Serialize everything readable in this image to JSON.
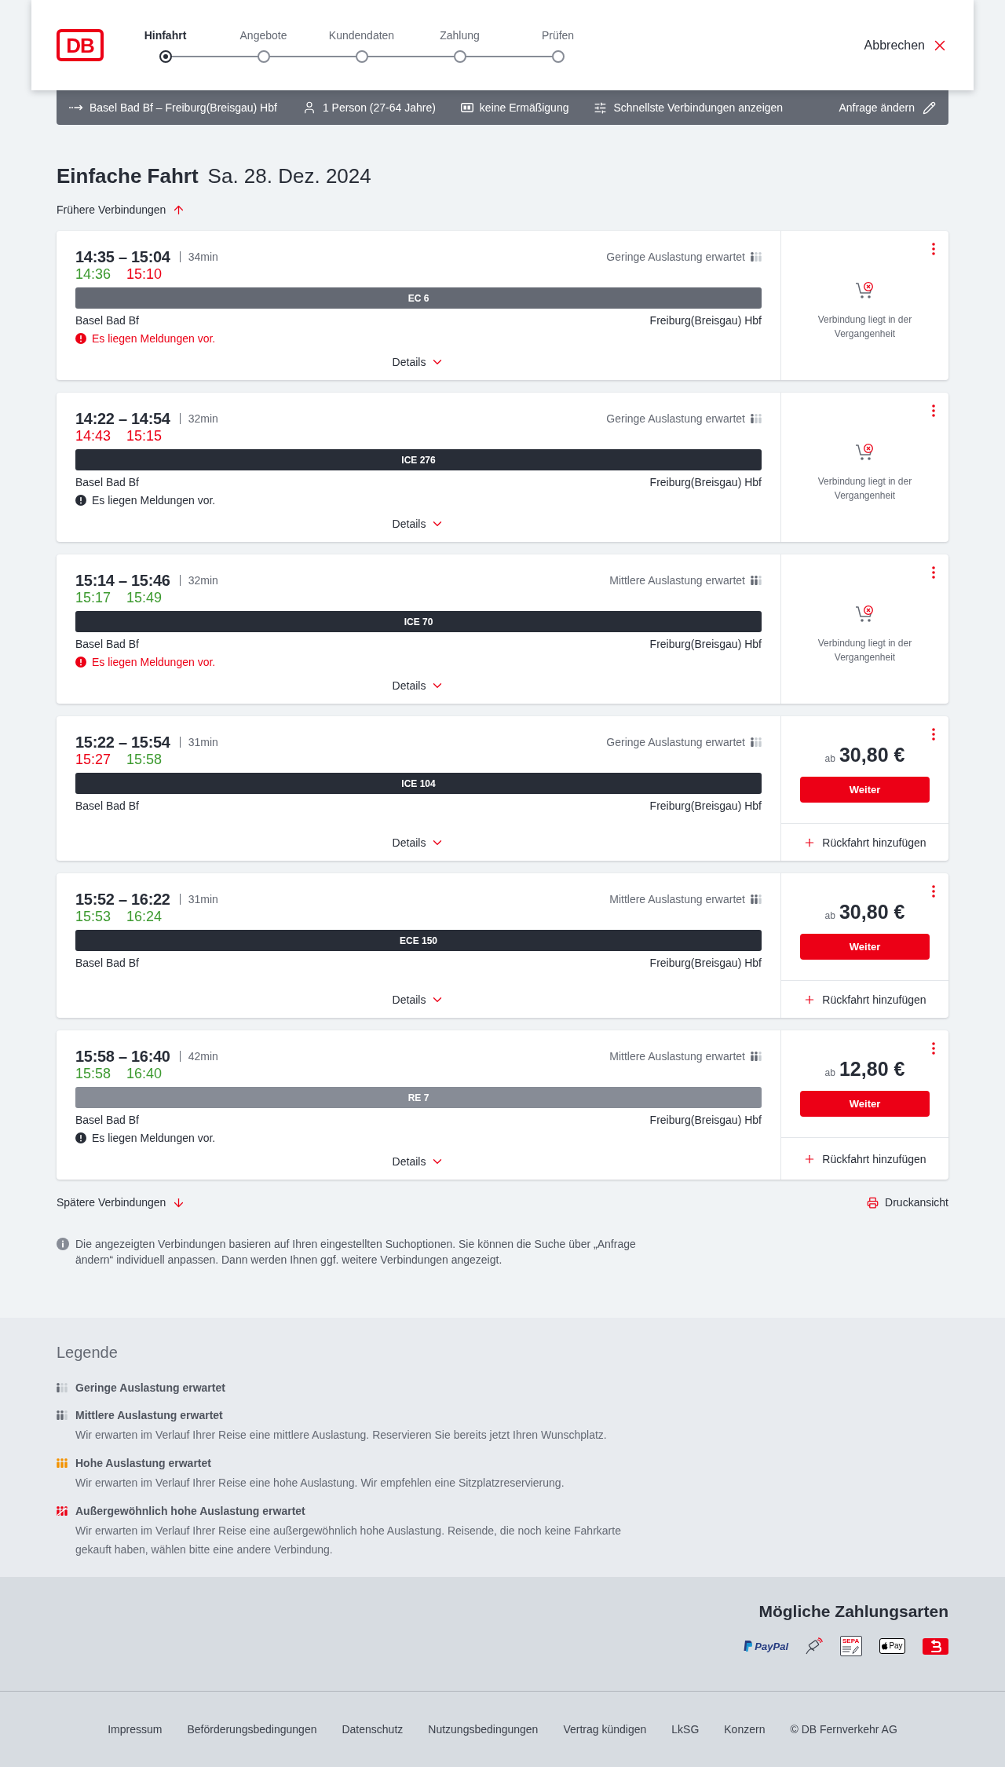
{
  "header": {
    "logo": "DB",
    "steps": [
      {
        "label": "Hinfahrt",
        "selected": true
      },
      {
        "label": "Angebote",
        "selected": false
      },
      {
        "label": "Kundendaten",
        "selected": false
      },
      {
        "label": "Zahlung",
        "selected": false
      },
      {
        "label": "Prüfen",
        "selected": false
      }
    ],
    "cancel": "Abbrechen"
  },
  "search_bar": {
    "route": "Basel Bad Bf – Freiburg(Breisgau) Hbf",
    "travellers": "1 Person (27-64 Jahre)",
    "discount": "keine Ermäßigung",
    "option": "Schnellste Verbindungen anzeigen",
    "edit": "Anfrage ändern"
  },
  "title": {
    "heading": "Einfache Fahrt",
    "date": "Sa. 28. Dez. 2024"
  },
  "earlier": "Frühere Verbindungen",
  "connections": [
    {
      "planned": "14:35 – 15:04",
      "duration": "34min",
      "occupancy": {
        "kind": "low",
        "label": "Geringe Auslastung erwartet"
      },
      "actual": [
        {
          "time": "14:36",
          "delayed": false
        },
        {
          "time": "15:10",
          "delayed": true
        }
      ],
      "train": {
        "name": "EC 6",
        "color": "#646973"
      },
      "from": "Basel Bad Bf",
      "to": "Freiburg(Breisgau) Hbf",
      "message": {
        "text": "Es liegen Meldungen vor.",
        "critical": true
      },
      "details": "Details",
      "offer": {
        "kind": "past",
        "text": "Verbindung liegt in der Vergangenheit"
      }
    },
    {
      "planned": "14:22 – 14:54",
      "duration": "32min",
      "occupancy": {
        "kind": "low",
        "label": "Geringe Auslastung erwartet"
      },
      "actual": [
        {
          "time": "14:43",
          "delayed": true
        },
        {
          "time": "15:15",
          "delayed": true
        }
      ],
      "train": {
        "name": "ICE 276",
        "color": "#282d37"
      },
      "from": "Basel Bad Bf",
      "to": "Freiburg(Breisgau) Hbf",
      "message": {
        "text": "Es liegen Meldungen vor.",
        "critical": false
      },
      "details": "Details",
      "offer": {
        "kind": "past",
        "text": "Verbindung liegt in der Vergangenheit"
      }
    },
    {
      "planned": "15:14 – 15:46",
      "duration": "32min",
      "occupancy": {
        "kind": "medium",
        "label": "Mittlere Auslastung erwartet"
      },
      "actual": [
        {
          "time": "15:17",
          "delayed": false
        },
        {
          "time": "15:49",
          "delayed": false
        }
      ],
      "train": {
        "name": "ICE 70",
        "color": "#282d37"
      },
      "from": "Basel Bad Bf",
      "to": "Freiburg(Breisgau) Hbf",
      "message": {
        "text": "Es liegen Meldungen vor.",
        "critical": true
      },
      "details": "Details",
      "offer": {
        "kind": "past",
        "text": "Verbindung liegt in der Vergangenheit"
      }
    },
    {
      "planned": "15:22 – 15:54",
      "duration": "31min",
      "occupancy": {
        "kind": "low",
        "label": "Geringe Auslastung erwartet"
      },
      "actual": [
        {
          "time": "15:27",
          "delayed": true
        },
        {
          "time": "15:58",
          "delayed": false
        }
      ],
      "train": {
        "name": "ICE 104",
        "color": "#282d37"
      },
      "from": "Basel Bad Bf",
      "to": "Freiburg(Breisgau) Hbf",
      "details": "Details",
      "offer": {
        "kind": "price",
        "prefix": "ab",
        "price": "30,80 €",
        "button": "Weiter",
        "return": "Rückfahrt hinzufügen"
      }
    },
    {
      "planned": "15:52 – 16:22",
      "duration": "31min",
      "occupancy": {
        "kind": "medium",
        "label": "Mittlere Auslastung erwartet"
      },
      "actual": [
        {
          "time": "15:53",
          "delayed": false
        },
        {
          "time": "16:24",
          "delayed": false
        }
      ],
      "train": {
        "name": "ECE 150",
        "color": "#282d37"
      },
      "from": "Basel Bad Bf",
      "to": "Freiburg(Breisgau) Hbf",
      "details": "Details",
      "offer": {
        "kind": "price",
        "prefix": "ab",
        "price": "30,80 €",
        "button": "Weiter",
        "return": "Rückfahrt hinzufügen"
      }
    },
    {
      "planned": "15:58 – 16:40",
      "duration": "42min",
      "occupancy": {
        "kind": "medium",
        "label": "Mittlere Auslastung erwartet"
      },
      "actual": [
        {
          "time": "15:58",
          "delayed": false
        },
        {
          "time": "16:40",
          "delayed": false
        }
      ],
      "train": {
        "name": "RE 7",
        "color": "#878c96"
      },
      "from": "Basel Bad Bf",
      "to": "Freiburg(Breisgau) Hbf",
      "message": {
        "text": "Es liegen Meldungen vor.",
        "critical": false
      },
      "details": "Details",
      "offer": {
        "kind": "price",
        "prefix": "ab",
        "price": "12,80 €",
        "button": "Weiter",
        "return": "Rückfahrt hinzufügen"
      }
    }
  ],
  "later": "Spätere Verbindungen",
  "print": "Druckansicht",
  "notice": "Die angezeigten Verbindungen basieren auf Ihren eingestellten Suchoptionen. Sie können die Suche über „Anfrage ändern“ individuell anpassen. Dann werden Ihnen ggf. weitere Verbindungen angezeigt.",
  "legend": {
    "title": "Legende",
    "items": [
      {
        "kind": "low",
        "label": "Geringe Auslastung erwartet"
      },
      {
        "kind": "medium",
        "label": "Mittlere Auslastung erwartet",
        "description": "Wir erwarten im Verlauf Ihrer Reise eine mittlere Auslastung. Reservieren Sie bereits jetzt Ihren Wunschplatz."
      },
      {
        "kind": "high",
        "label": "Hohe Auslastung erwartet",
        "description": "Wir erwarten im Verlauf Ihrer Reise eine hohe Auslastung. Wir empfehlen eine Sitzplatzreservierung."
      },
      {
        "kind": "extreme",
        "label": "Außergewöhnlich hohe Auslastung erwartet",
        "description": "Wir erwarten im Verlauf Ihrer Reise eine außergewöhnlich hohe Auslastung. Reisende, die noch keine Fahrkarte gekauft haben, wählen bitte eine andere Verbindung."
      }
    ]
  },
  "payment": {
    "title": "Mögliche Zahlungsarten",
    "methods": [
      {
        "kind": "paypal",
        "label": "PayPal"
      },
      {
        "kind": "card"
      },
      {
        "kind": "sepa",
        "label": "SEPA"
      },
      {
        "kind": "applepay",
        "label": "Pay"
      },
      {
        "kind": "bonus"
      }
    ]
  },
  "footer": {
    "links": [
      "Impressum",
      "Beförderungsbedingungen",
      "Datenschutz",
      "Nutzungsbedingungen",
      "Vertrag kündigen",
      "LkSG",
      "Konzern"
    ],
    "copyright": "© DB Fernverkehr AG"
  }
}
